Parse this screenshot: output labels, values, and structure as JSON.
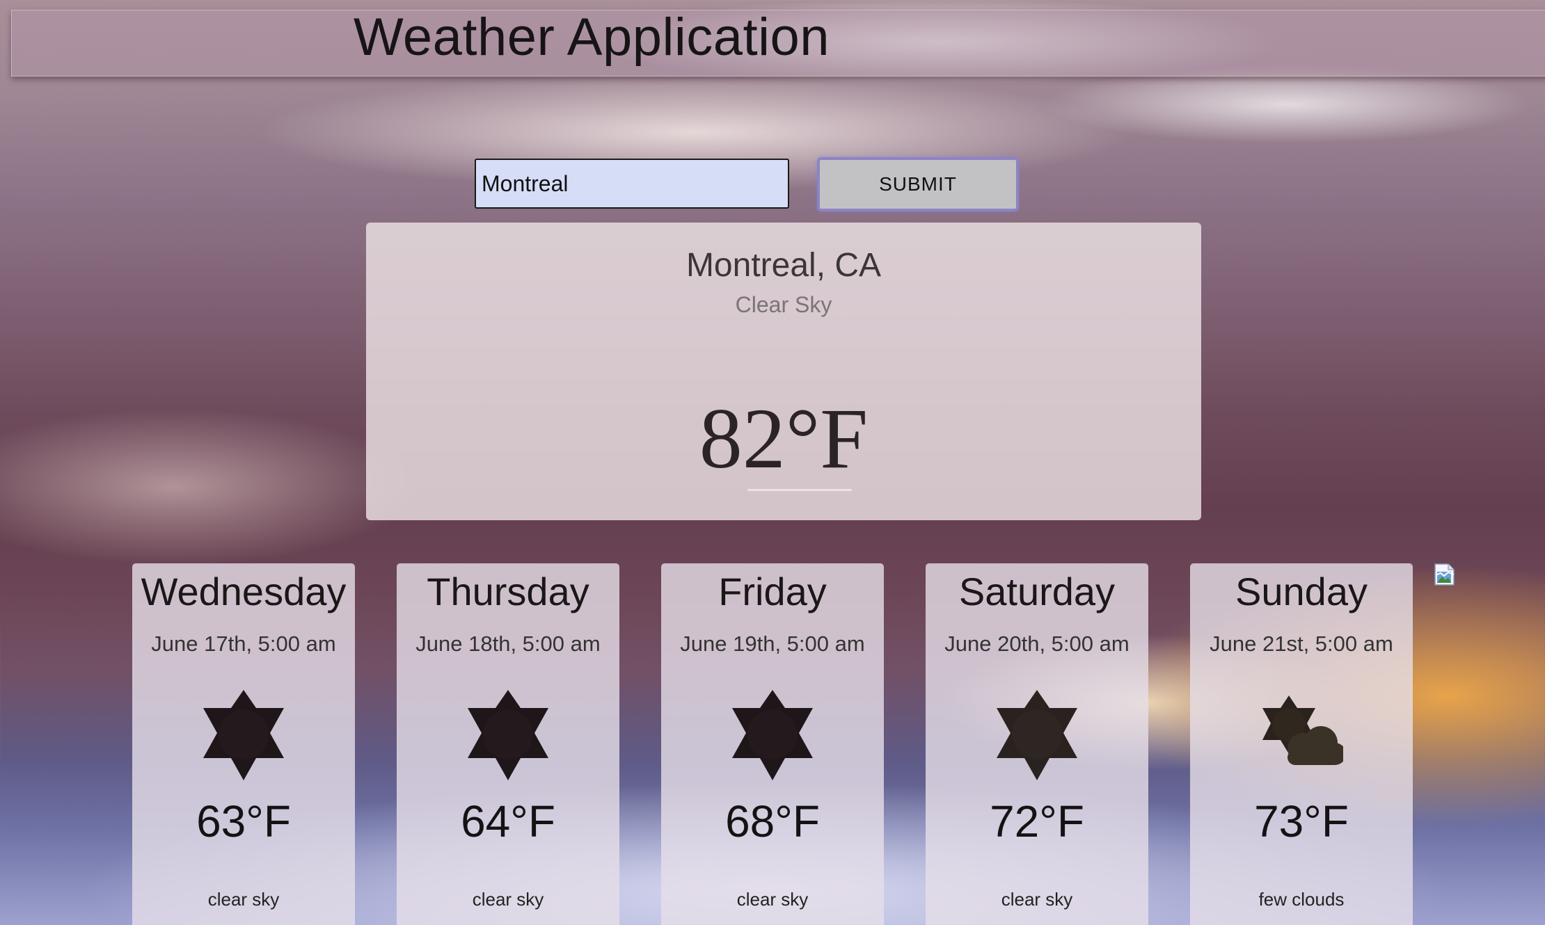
{
  "header": {
    "title": "Weather Application"
  },
  "search": {
    "value": "Montreal",
    "submit_label": "SUBMIT"
  },
  "current": {
    "location": "Montreal, CA",
    "description": "Clear Sky",
    "temperature": "82°F"
  },
  "forecast": [
    {
      "day": "Wednesday",
      "date": "June 17th, 5:00 am",
      "icon": "clear-sky-sun-icon",
      "temp": "63°F",
      "desc": "clear sky"
    },
    {
      "day": "Thursday",
      "date": "June 18th, 5:00 am",
      "icon": "clear-sky-sun-icon",
      "temp": "64°F",
      "desc": "clear sky"
    },
    {
      "day": "Friday",
      "date": "June 19th, 5:00 am",
      "icon": "clear-sky-sun-icon",
      "temp": "68°F",
      "desc": "clear sky"
    },
    {
      "day": "Saturday",
      "date": "June 20th, 5:00 am",
      "icon": "clear-sky-sun-icon",
      "temp": "72°F",
      "desc": "clear sky"
    },
    {
      "day": "Sunday",
      "date": "June 21st, 5:00 am",
      "icon": "few-clouds-icon",
      "temp": "73°F",
      "desc": "few clouds"
    }
  ],
  "colors": {
    "input_bg": "#d6ddf6",
    "button_bg": "#c2c2c4",
    "button_focus_ring": "#8d84c4",
    "icon_fill": "#1e1619"
  }
}
